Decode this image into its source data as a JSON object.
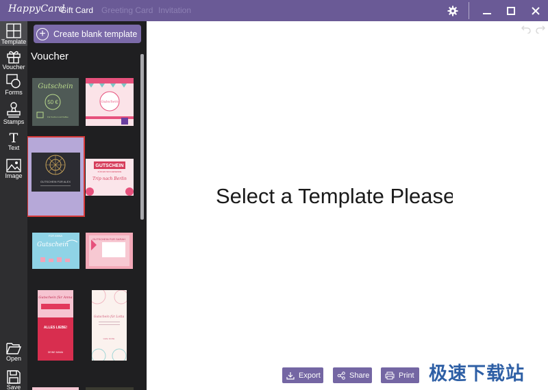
{
  "titlebar": {
    "logo": "HappyCard",
    "tabs": [
      {
        "label": "Gift Card"
      },
      {
        "label": "Greeting Card"
      },
      {
        "label": "Invitation"
      }
    ],
    "icons": [
      "gear-icon",
      "minimize-icon",
      "maximize-icon",
      "close-icon"
    ]
  },
  "leftbar": {
    "tools": [
      {
        "label": "Template",
        "icon": "template-grid-icon"
      },
      {
        "label": "Voucher",
        "icon": "gift-icon"
      },
      {
        "label": "Forms",
        "icon": "shapes-icon"
      },
      {
        "label": "Stamps",
        "icon": "stamp-icon"
      },
      {
        "label": "Text",
        "icon": "text-icon"
      },
      {
        "label": "Image",
        "icon": "image-icon"
      },
      {
        "label": "Open",
        "icon": "folder-icon"
      },
      {
        "label": "Save",
        "icon": "floppy-icon"
      }
    ]
  },
  "panel": {
    "create_label": "Create blank template",
    "title": "Voucher",
    "thumbnails": [
      {
        "main": "Gutschein",
        "value": "50 €",
        "foot": "Für Kuchen und Kaffee"
      },
      {
        "main": "Gutschein"
      },
      {
        "main": "GUTSCHEIN FÜR ALEX"
      },
      {
        "main": "GUTSCHEIN",
        "sub": "FÜR EIN WOCHENENDE",
        "foot": "Trip nach Berlin"
      },
      {
        "main": "Gutschein",
        "top": "FÜR ANNA"
      },
      {
        "main": "GUTSCHEIN FÜR SARAH"
      },
      {
        "main": "Gutschein für Anna",
        "sub": "ALLES LIEBE!",
        "foot": "DEINE MAMA"
      },
      {
        "main": "Gutschein für Lotta",
        "foot": "Liebe Grüße"
      }
    ]
  },
  "canvas": {
    "message": "Select a Template Please",
    "actions": [
      {
        "label": "Export",
        "icon": "export-icon"
      },
      {
        "label": "Share",
        "icon": "share-icon"
      },
      {
        "label": "Print",
        "icon": "print-icon"
      }
    ],
    "undo_icons": [
      "undo-icon",
      "redo-icon"
    ]
  },
  "watermark": "极速下载站",
  "colors": {
    "titlebar": "#6a5a96",
    "accent": "#7b6aa9",
    "panel": "#1f1f21",
    "toolbar": "#2e2e30",
    "selection": "#d93b3b"
  }
}
